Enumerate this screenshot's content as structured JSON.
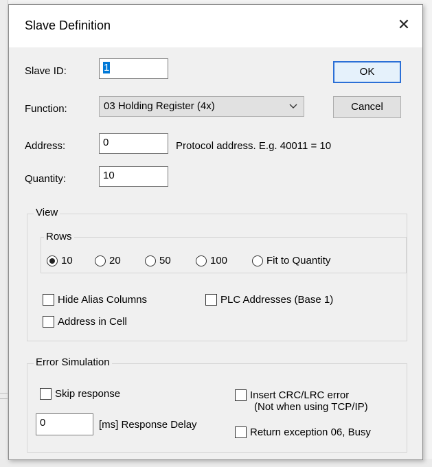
{
  "dialog": {
    "title": "Slave Definition",
    "close_glyph": "✕"
  },
  "fields": {
    "slave_id_label": "Slave ID:",
    "slave_id_value": "1",
    "function_label": "Function:",
    "function_value": "03 Holding Register (4x)",
    "address_label": "Address:",
    "address_value": "0",
    "address_hint": "Protocol address. E.g. 40011 = 10",
    "quantity_label": "Quantity:",
    "quantity_value": "10"
  },
  "buttons": {
    "ok": "OK",
    "cancel": "Cancel"
  },
  "view": {
    "title": "View",
    "rows_title": "Rows",
    "rows_options": [
      "10",
      "20",
      "50",
      "100",
      "Fit to Quantity"
    ],
    "rows_selected": "10",
    "hide_alias_columns": "Hide Alias Columns",
    "plc_addresses": "PLC Addresses (Base 1)",
    "address_in_cell": "Address in Cell"
  },
  "error_simulation": {
    "title": "Error Simulation",
    "skip_response": "Skip response",
    "delay_value": "0",
    "delay_label": "[ms] Response Delay",
    "insert_crc_line1": "Insert CRC/LRC error",
    "insert_crc_line2": "(Not when using TCP/IP)",
    "return_exception": "Return exception 06, Busy"
  },
  "icons": {
    "close": "close-icon",
    "dropdown": "chevron-down-icon"
  }
}
